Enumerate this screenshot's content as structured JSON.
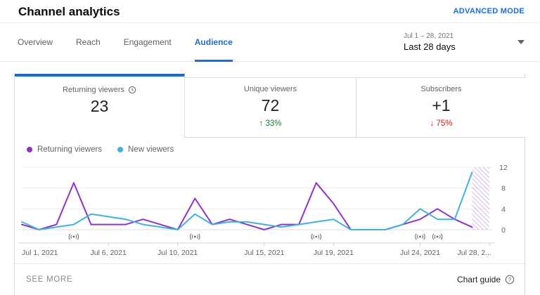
{
  "header": {
    "title": "Channel analytics",
    "advanced_mode_label": "ADVANCED MODE"
  },
  "tabs": {
    "items": [
      {
        "label": "Overview",
        "active": false
      },
      {
        "label": "Reach",
        "active": false
      },
      {
        "label": "Engagement",
        "active": false
      },
      {
        "label": "Audience",
        "active": true
      }
    ]
  },
  "date_picker": {
    "range": "Jul 1 – 28, 2021",
    "preset": "Last 28 days",
    "caret_icon": "chevron-down-icon"
  },
  "metric_cards": [
    {
      "label": "Returning viewers",
      "value": "23",
      "info_icon": "clock-icon",
      "active": true
    },
    {
      "label": "Unique viewers",
      "value": "72",
      "delta": "33%",
      "delta_arrow": "↑",
      "direction": "up",
      "active": false
    },
    {
      "label": "Subscribers",
      "value": "+1",
      "delta": "75%",
      "delta_arrow": "↓",
      "direction": "down",
      "active": false
    }
  ],
  "legend": [
    {
      "label": "Returning viewers",
      "color": "#8e32c8"
    },
    {
      "label": "New viewers",
      "color": "#41b2dd"
    }
  ],
  "chart_data": {
    "type": "line",
    "title": "Audience over time",
    "x_unit": "day of July 2021",
    "x": [
      1,
      2,
      3,
      4,
      5,
      6,
      7,
      8,
      9,
      10,
      11,
      12,
      13,
      14,
      15,
      16,
      17,
      18,
      19,
      20,
      21,
      22,
      23,
      24,
      25,
      26,
      27
    ],
    "series": [
      {
        "name": "Returning viewers",
        "color": "#8e32c8",
        "values": [
          1,
          0,
          1,
          9,
          1,
          1,
          1,
          2,
          1,
          0,
          6,
          1,
          2,
          1,
          0,
          1,
          1,
          9,
          5,
          0,
          0,
          0,
          1,
          2,
          4,
          2,
          0.5
        ]
      },
      {
        "name": "New viewers",
        "color": "#41b2dd",
        "values": [
          1.5,
          0,
          0.5,
          1,
          3,
          2.5,
          2,
          1,
          0.5,
          0,
          3,
          1,
          1.5,
          1.5,
          1,
          0.5,
          1,
          1.5,
          2,
          0,
          0,
          0,
          1,
          4,
          2,
          2,
          11
        ]
      }
    ],
    "ylim": [
      0,
      12
    ],
    "yticks": [
      0,
      4,
      8,
      12
    ],
    "x_domain": [
      1,
      28
    ],
    "xticks": [
      {
        "day": 1,
        "label": "Jul 1, 2021",
        "anchor": "start"
      },
      {
        "day": 6,
        "label": "Jul 6, 2021",
        "anchor": "middle"
      },
      {
        "day": 10,
        "label": "Jul 10, 2021",
        "anchor": "middle"
      },
      {
        "day": 15,
        "label": "Jul 15, 2021",
        "anchor": "middle"
      },
      {
        "day": 19,
        "label": "Jul 19, 2021",
        "anchor": "middle"
      },
      {
        "day": 24,
        "label": "Jul 24, 2021",
        "anchor": "middle"
      },
      {
        "day": 28,
        "label": "Jul 28, 2...",
        "anchor": "end"
      }
    ],
    "live_marker_days": [
      4,
      11,
      18,
      24,
      25
    ],
    "live_marker_icon": "live-stream-icon",
    "partial_data_region": {
      "from_day": 27,
      "to_day": 28,
      "style": "purple-hatched"
    },
    "grid": true,
    "legend_position": "top-left",
    "y_axis_side": "right"
  },
  "footer": {
    "see_more": "SEE MORE",
    "chart_guide": "Chart guide",
    "guide_icon": "help-icon"
  },
  "colors": {
    "accent_blue": "#1a6dd8",
    "returning_purple": "#8e32c8",
    "new_cyan": "#41b2dd",
    "delta_up_green": "#188038",
    "delta_down_red": "#c5221f",
    "hatch_purple": "#c9a2e2"
  }
}
